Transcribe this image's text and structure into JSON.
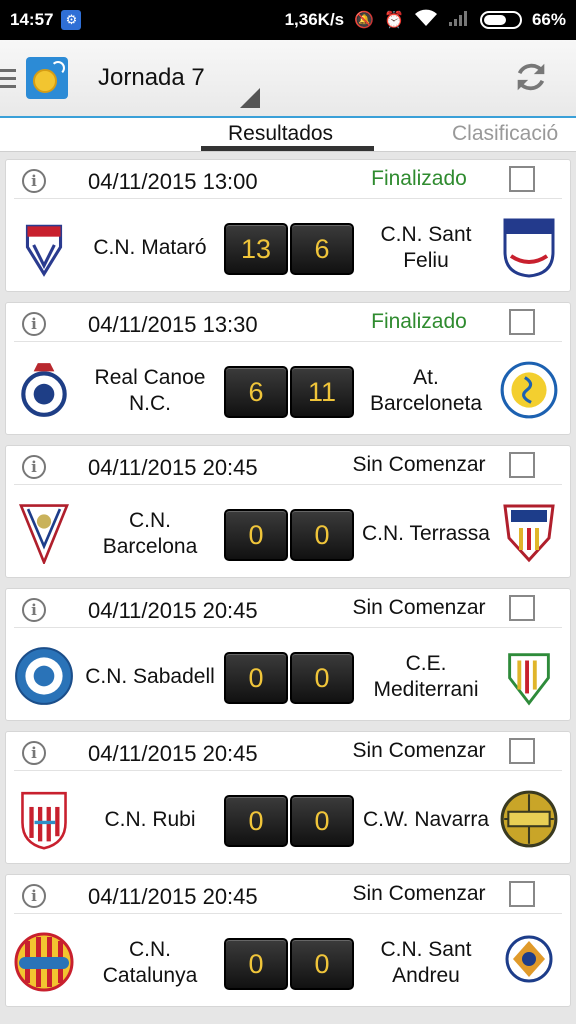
{
  "status_bar": {
    "time": "14:57",
    "net_speed": "1,36K/s",
    "battery": "66%"
  },
  "header": {
    "title": "Jornada 7"
  },
  "tabs": [
    {
      "label": "Resultados"
    },
    {
      "label": "Clasificació"
    }
  ],
  "colors": {
    "finished": "#2f8b2f",
    "score_text": "#f0c53a",
    "accent": "#3aa0d8"
  },
  "matches": [
    {
      "datetime": "04/11/2015 13:00",
      "status": "Finalizado",
      "home": "C.N. Mataró",
      "away": "C.N. Sant Feliu",
      "home_score": "13",
      "away_score": "6"
    },
    {
      "datetime": "04/11/2015 13:30",
      "status": "Finalizado",
      "home": "Real Canoe N.C.",
      "away": "At. Barceloneta",
      "home_score": "6",
      "away_score": "11"
    },
    {
      "datetime": "04/11/2015 20:45",
      "status": "Sin Comenzar",
      "home": "C.N. Barcelona",
      "away": "C.N. Terrassa",
      "home_score": "0",
      "away_score": "0"
    },
    {
      "datetime": "04/11/2015 20:45",
      "status": "Sin Comenzar",
      "home": "C.N. Sabadell",
      "away": "C.E. Mediterrani",
      "home_score": "0",
      "away_score": "0"
    },
    {
      "datetime": "04/11/2015 20:45",
      "status": "Sin Comenzar",
      "home": "C.N. Rubi",
      "away": "C.W. Navarra",
      "home_score": "0",
      "away_score": "0"
    },
    {
      "datetime": "04/11/2015 20:45",
      "status": "Sin Comenzar",
      "home": "C.N. Catalunya",
      "away": "C.N. Sant Andreu",
      "home_score": "0",
      "away_score": "0"
    }
  ]
}
